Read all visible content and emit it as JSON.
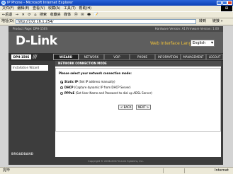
{
  "window": {
    "title": "IP Phone - Microsoft Internet Explorer",
    "menu": [
      "文件(F)",
      "编辑(E)",
      "查看(V)",
      "收藏(A)",
      "工具(T)",
      "帮助(H)"
    ],
    "toolbar": [
      "←后退",
      "→",
      "✕",
      "⟳",
      "⌂",
      "搜索",
      "收藏夹",
      "媒体",
      "⦿",
      "✉",
      "🖶",
      "📝"
    ],
    "address_label": "地址(D)",
    "address_value": "http://172.16.1.254/",
    "go_label": "转到",
    "links_label": "链接 »"
  },
  "header": {
    "product_page": "Product Page: DPH-150S",
    "version": "Hardware Version: A1   Firmware Version: 1.00",
    "logo": "D-Link",
    "lang_label": "Web Interface Language",
    "lang_value": "English"
  },
  "nav": {
    "model": "DPH-150S",
    "tabs": [
      "WIZARD",
      "NETWORK",
      "VOIP",
      "PHONE",
      "INFORMATION",
      "MANAGEMENT",
      "LOGOUT"
    ],
    "active_tab": "WIZARD"
  },
  "sidebar": {
    "items": [
      "Installation Wizard"
    ],
    "footer": "BROADBAND"
  },
  "main": {
    "section_title": "NETWORK CONNECTION MODE",
    "prompt": "Please select your network connection mode:",
    "options": [
      {
        "name": "Static IP",
        "desc": "(Set IP address manually)",
        "selected": true
      },
      {
        "name": "DHCP",
        "desc": "(Capture dynamic IP from DHCP Server)",
        "selected": false
      },
      {
        "name": "PPPoE",
        "desc": "(Set User Name and Password to dial up ADSL Server)",
        "selected": false
      }
    ],
    "back_label": "< BACK",
    "next_label": "NEXT >",
    "copyright": "Copyright © 2006-2007 D-Link Systems, Inc."
  },
  "status": {
    "left": "完毕",
    "right": "Internet"
  }
}
